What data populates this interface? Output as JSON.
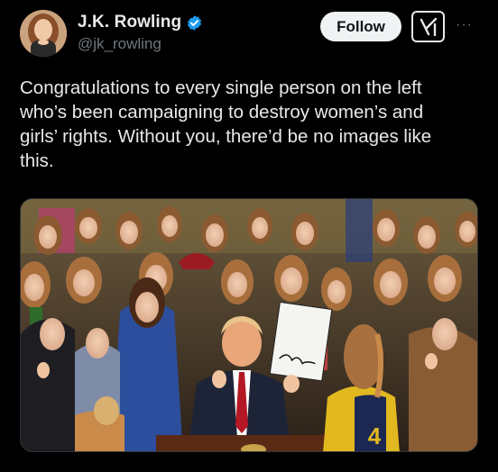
{
  "author": {
    "display_name": "J.K. Rowling",
    "handle": "@jk_rowling",
    "verified": true,
    "avatar_icon": "profile-photo"
  },
  "actions": {
    "follow_label": "Follow",
    "grok_icon": "grok-icon",
    "more_icon": "more-icon",
    "more_glyph": "···"
  },
  "post": {
    "text": "Congratulations to every single person on the left\nwho’s been campaigning to destroy women’s and\ngirls’ rights. Without you, there’d be no images like\nthis."
  },
  "media": {
    "type": "photo",
    "signed_document_text": "[signature]",
    "jersey_number": "4"
  },
  "colors": {
    "background": "#000000",
    "text": "#e7e9ea",
    "secondary_text": "#71767b",
    "verified_blue": "#1d9bf0",
    "follow_bg": "#eff3f4"
  }
}
